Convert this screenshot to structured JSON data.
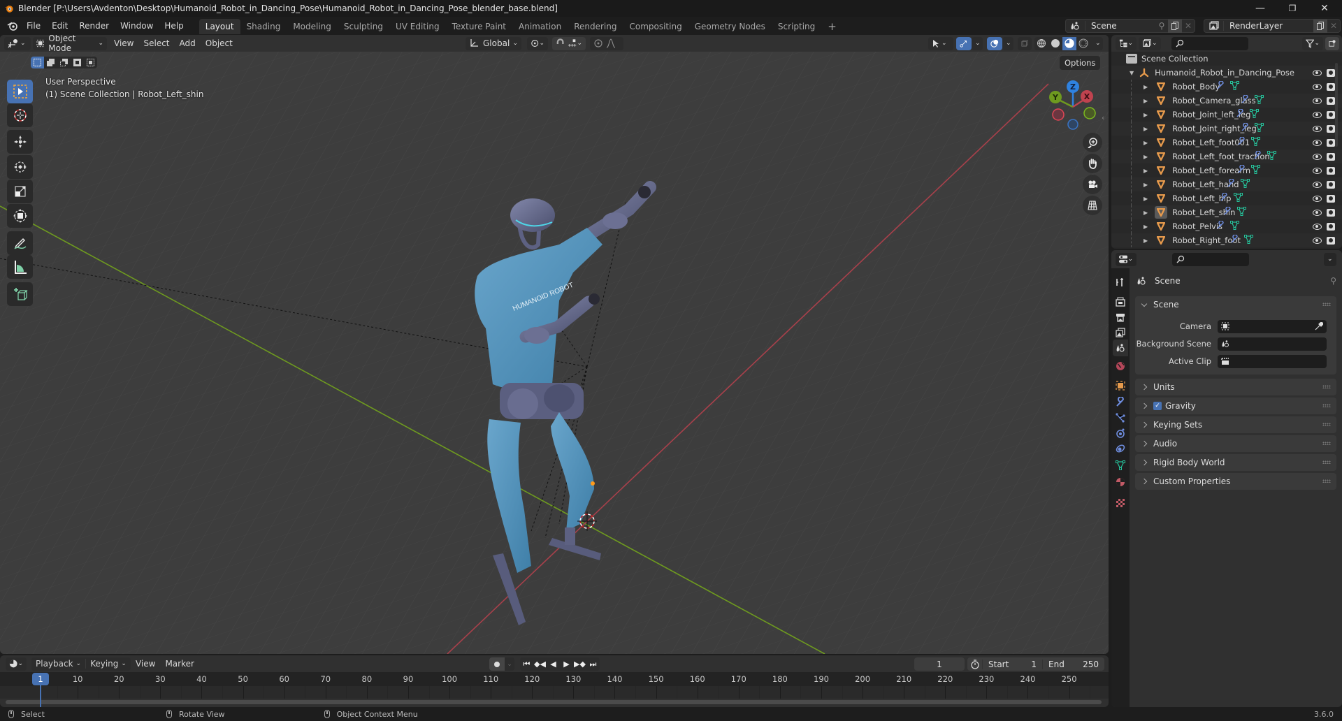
{
  "app": {
    "title": "Blender [P:\\Users\\Avdenton\\Desktop\\Humanoid_Robot_in_Dancing_Pose\\Humanoid_Robot_in_Dancing_Pose_blender_base.blend]",
    "version": "3.6.0",
    "accent_color": "#4772b3"
  },
  "window_controls": {
    "minimize": "—",
    "maximize": "❐",
    "close": "✕"
  },
  "menu": [
    "File",
    "Edit",
    "Render",
    "Window",
    "Help"
  ],
  "workspaces": {
    "active": "Layout",
    "tabs": [
      "Layout",
      "Shading",
      "Modeling",
      "Sculpting",
      "UV Editing",
      "Texture Paint",
      "Animation",
      "Rendering",
      "Compositing",
      "Geometry Nodes",
      "Scripting"
    ],
    "add_label": "+"
  },
  "scene_selector": {
    "value": "Scene"
  },
  "view_layer_selector": {
    "value": "RenderLayer"
  },
  "viewport": {
    "mode": "Object Mode",
    "menus": [
      "View",
      "Select",
      "Add",
      "Object"
    ],
    "transform_orientation": "Global",
    "options_label": "Options",
    "view_name": "User Perspective",
    "context": "(1) Scene Collection | Robot_Left_shin",
    "gizmo": {
      "x": "X",
      "y": "Y",
      "z": "Z"
    },
    "shirt_text": "HUMANOID ROBOT",
    "axis_colors": {
      "x": "#c0434f",
      "y": "#6e9a1f",
      "z": "#2f82e0"
    }
  },
  "outliner": {
    "root": "Scene Collection",
    "collection": "Humanoid_Robot_in_Dancing_Pose",
    "objects": [
      "Robot_Body",
      "Robot_Camera_glass",
      "Robot_Joint_left_leg",
      "Robot_Joint_right_leg",
      "Robot_Left_foot001",
      "Robot_Left_foot_traction",
      "Robot_Left_forearm",
      "Robot_Left_hand",
      "Robot_Left_hip",
      "Robot_Left_shin",
      "Robot_Pelvis",
      "Robot_Right_foot"
    ],
    "active_object": "Robot_Left_shin"
  },
  "properties": {
    "context_title": "Scene",
    "scene_panel": {
      "title": "Scene",
      "fields": [
        {
          "label": "Camera",
          "value": ""
        },
        {
          "label": "Background Scene",
          "value": ""
        },
        {
          "label": "Active Clip",
          "value": ""
        }
      ]
    },
    "collapsed_panels": [
      "Units",
      "Gravity",
      "Keying Sets",
      "Audio",
      "Rigid Body World",
      "Custom Properties"
    ],
    "gravity_enabled": true,
    "tabs": [
      "tool",
      "render",
      "output",
      "view-layer",
      "scene",
      "world",
      "object",
      "modifiers",
      "particles",
      "physics",
      "constraints",
      "data",
      "material",
      "texture"
    ],
    "active_tab": "scene"
  },
  "timeline": {
    "menus": [
      "Playback",
      "Keying",
      "View",
      "Marker"
    ],
    "current_frame": "1",
    "start_label": "Start",
    "start": "1",
    "end_label": "End",
    "end": "250",
    "ticks": [
      "10",
      "20",
      "30",
      "40",
      "50",
      "60",
      "70",
      "80",
      "90",
      "100",
      "110",
      "120",
      "130",
      "140",
      "150",
      "160",
      "170",
      "180",
      "190",
      "200",
      "210",
      "220",
      "230",
      "240",
      "250"
    ],
    "playhead_label": "1"
  },
  "statusbar": {
    "left": "Select",
    "middle": "Rotate View",
    "right": "Object Context Menu"
  }
}
